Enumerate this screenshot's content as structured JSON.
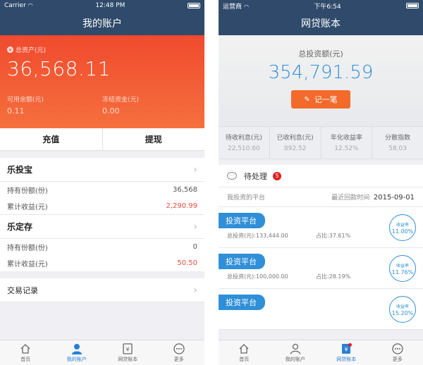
{
  "left": {
    "status": {
      "carrier": "Carrier",
      "time": "12:48 PM"
    },
    "nav_title": "我的账户",
    "total_asset_label": "总资产(元)",
    "total_asset_value": "36,568.11",
    "available_label": "可用余额(元)",
    "available_value": "0.11",
    "frozen_label": "冻结资金(元)",
    "frozen_value": "0.00",
    "actions": {
      "recharge": "充值",
      "withdraw": "提现"
    },
    "cards": [
      {
        "title": "乐投宝",
        "rows": [
          {
            "label": "持有份额(份)",
            "value": "36,568"
          },
          {
            "label": "累计收益(元)",
            "value": "2,290.99"
          }
        ]
      },
      {
        "title": "乐定存",
        "rows": [
          {
            "label": "持有份额(份)",
            "value": "0"
          },
          {
            "label": "累计收益(元)",
            "value": "50.50"
          }
        ]
      }
    ],
    "transaction_record": "交易记录",
    "tabs": [
      "首页",
      "我的账户",
      "网贷账本",
      "更多"
    ]
  },
  "right": {
    "status": {
      "carrier": "运营商",
      "time": "下午6:54"
    },
    "nav_title": "网贷账本",
    "total_invest_label": "总投资额(元)",
    "total_invest_value": "354,791.59",
    "record_button": "记一笔",
    "stats": [
      {
        "label": "待收利息(元)",
        "value": "22,510.60"
      },
      {
        "label": "已收利息(元)",
        "value": "892.52"
      },
      {
        "label": "年化收益率",
        "value": "12.52%"
      },
      {
        "label": "分散指数",
        "value": "58.03"
      }
    ],
    "pending_label": "待处理",
    "pending_count": "5",
    "platforms_label": "我投资的平台",
    "last_payment_label": "最近回款时间",
    "last_payment_date": "2015-09-01",
    "platforms": [
      {
        "name": "投资平台",
        "amount": "总投资(元):133,444.00",
        "ratio": "占比:37.61%",
        "rate_label": "收益率",
        "rate": "11.00%"
      },
      {
        "name": "投资平台",
        "amount": "总投资(元):100,000.00",
        "ratio": "占比:28.19%",
        "rate_label": "收益率",
        "rate": "11.76%"
      },
      {
        "name": "投资平台",
        "amount": "",
        "ratio": "",
        "rate_label": "收益率",
        "rate": "15.20%"
      }
    ],
    "tabs": [
      "首页",
      "我的账户",
      "网贷账本",
      "更多"
    ]
  },
  "colors": {
    "nav": "#2f4a6a",
    "hero_red": "#f04a2e",
    "accent_blue": "#2f8fd8",
    "record_orange": "#f36a2b",
    "negative_red": "#e84b3c"
  }
}
